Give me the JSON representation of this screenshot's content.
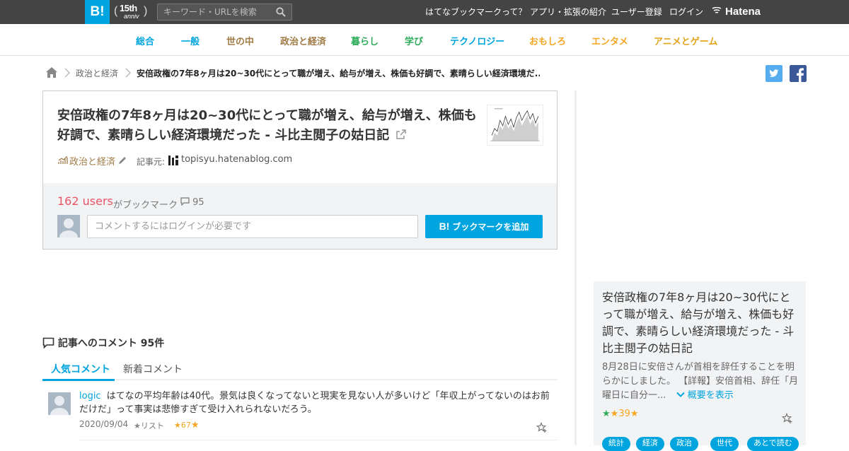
{
  "topbar": {
    "logo": "B!",
    "anniv_big": "15th",
    "anniv_small": "anniv",
    "search_placeholder": "キーワード・URLを検索",
    "nav": [
      "はてなブックマークって？",
      "アプリ・拡張の紹介",
      "ユーザー登録",
      "ログイン"
    ],
    "brand": "Hatena"
  },
  "categories": [
    {
      "label": "総合",
      "color": "#00a4de"
    },
    {
      "label": "一般",
      "color": "#00a4de"
    },
    {
      "label": "世の中",
      "color": "#a07b46"
    },
    {
      "label": "政治と経済",
      "color": "#a07b46"
    },
    {
      "label": "暮らし",
      "color": "#2eab5b"
    },
    {
      "label": "学び",
      "color": "#2eab5b"
    },
    {
      "label": "テクノロジー",
      "color": "#00a4de"
    },
    {
      "label": "おもしろ",
      "color": "#f5a623"
    },
    {
      "label": "エンタメ",
      "color": "#f5a623"
    },
    {
      "label": "アニメとゲーム",
      "color": "#e2a319"
    }
  ],
  "breadcrumb": {
    "category": "政治と経済",
    "current": "安倍政権の7年8ヶ月は20~30代にとって職が増え、給与が増え、株価も好調で、素晴らしい経済環境だ..."
  },
  "entry": {
    "title": "安倍政権の7年8ヶ月は20~30代にとって職が増え、給与が増え、株価も好調で、素晴らしい経済環境だった - 斗比主閲子の姑日記",
    "category": "政治と経済",
    "source_label": "記事元:",
    "source_domain": "topisyu.hatenablog.com",
    "users_count": "162 users",
    "bookmark_text": "がブックマーク",
    "comment_count": "95",
    "comment_placeholder": "コメントするにはログインが必要です",
    "add_button": "ブックマークを追加",
    "add_button_mark": "B!"
  },
  "comments": {
    "heading": "記事へのコメント 95件",
    "tabs": [
      "人気コメント",
      "新着コメント"
    ],
    "first": {
      "user": "logic",
      "text": "はてなの平均年齢は40代。景気は良くなってないと現実を見ない人が多いけど「年収上がってないのはお前だけだ」って事実は悲惨すぎて受け入れられないだろう。",
      "date": "2020/09/04",
      "list_label": "リスト",
      "stars": "67"
    }
  },
  "sidebar": {
    "title": "安倍政権の7年8ヶ月は20~30代にとって職が増え、給与が増え、株価も好調で、素晴らしい経済環境だった - 斗比主閲子の姑日記",
    "desc": "8月28日に安倍さんが首相を辞任することを明らかにしました。 【詳報】安倍首相、辞任「月曜日に自分一...",
    "more": "概要を表示",
    "stars": "39",
    "tags": [
      "統計",
      "経済",
      "政治",
      "世代",
      "あとで読む"
    ]
  }
}
